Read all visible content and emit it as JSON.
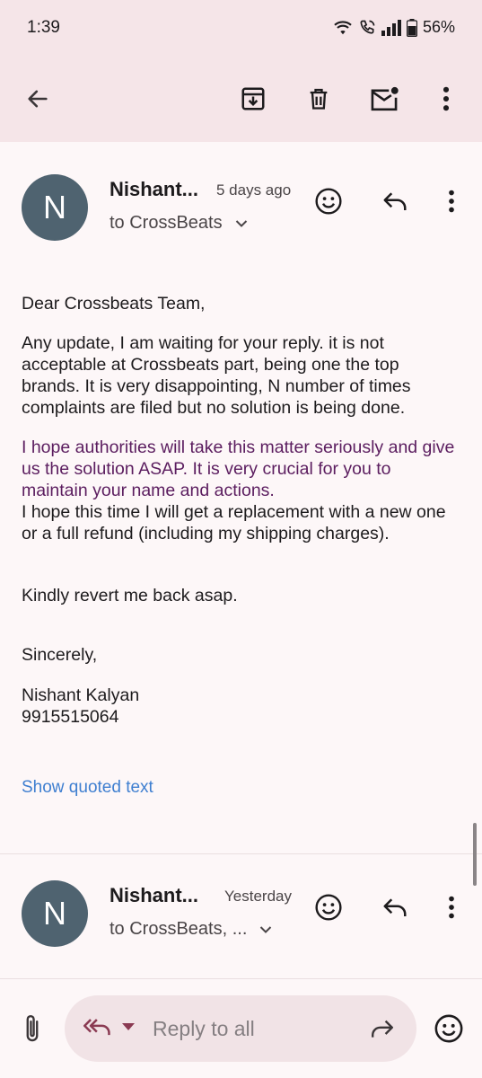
{
  "status": {
    "time": "1:39",
    "battery": "56%"
  },
  "toolbar": {
    "back_icon": "arrow-back-icon",
    "archive_icon": "archive-icon",
    "delete_icon": "trash-icon",
    "unread_icon": "mark-unread-icon",
    "more_icon": "more-vert-icon"
  },
  "message1": {
    "avatar_letter": "N",
    "sender": "Nishant...",
    "time": "5 days ago",
    "to": "to CrossBeats",
    "greeting": "Dear Crossbeats Team,",
    "para1": "Any update, I am waiting for your reply. it is not acceptable at Crossbeats part, being one the top brands. It is very disappointing, N number of times complaints are filed but no solution is being done.",
    "para2": "I hope authorities will take this matter seriously and give us the solution ASAP. It is very crucial for you to maintain your name and actions.",
    "para3": "I hope this time I will get a replacement with a new one or a full refund (including my shipping charges).",
    "para4": "Kindly revert me back asap.",
    "closing": "Sincerely,",
    "sig_name": "Nishant Kalyan",
    "sig_phone": "9915515064",
    "show_quoted": "Show quoted text"
  },
  "message2": {
    "avatar_letter": "N",
    "sender": "Nishant...",
    "time": "Yesterday",
    "to": "to CrossBeats, ..."
  },
  "reply_bar": {
    "placeholder": "Reply to all"
  },
  "colors": {
    "appbar": "#f5e5e8",
    "avatar": "#4f6370",
    "link": "#3f7fd0",
    "highlight_text": "#5b1d5f"
  }
}
